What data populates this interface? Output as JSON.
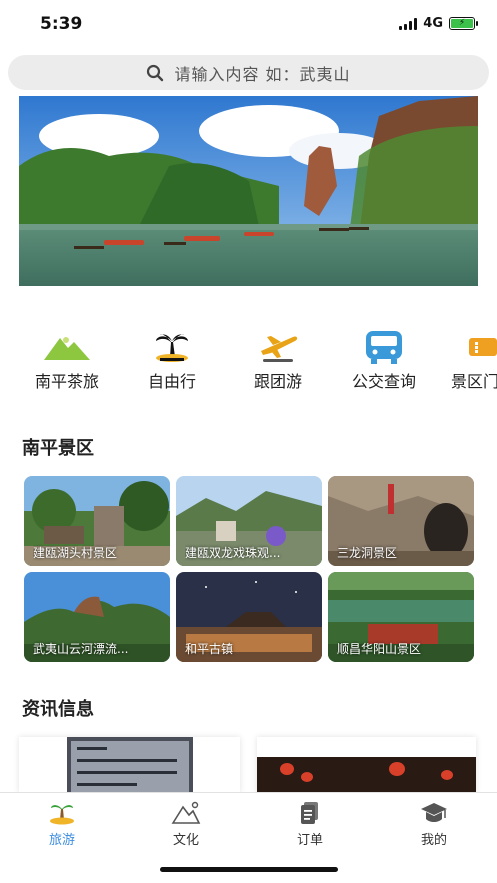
{
  "status_bar": {
    "time": "5:39",
    "network": "4G"
  },
  "search": {
    "placeholder": "请输入内容  如：武夷山",
    "icon": "search-icon"
  },
  "banner": {
    "scene": "river-valley-rafting"
  },
  "categories": [
    {
      "label": "南平茶旅",
      "icon": "tea-mountain-icon"
    },
    {
      "label": "自由行",
      "icon": "palm-island-icon"
    },
    {
      "label": "跟团游",
      "icon": "airplane-icon"
    },
    {
      "label": "公交查询",
      "icon": "bus-icon"
    },
    {
      "label": "景区门",
      "icon": "ticket-icon"
    }
  ],
  "scenic": {
    "title": "南平景区",
    "items": [
      {
        "label": "建瓯湖头村景区"
      },
      {
        "label": "建瓯双龙戏珠观..."
      },
      {
        "label": "三龙洞景区"
      },
      {
        "label": "武夷山云河漂流..."
      },
      {
        "label": "和平古镇"
      },
      {
        "label": "顺昌华阳山景区"
      }
    ]
  },
  "news": {
    "title": "资讯信息"
  },
  "tabbar": {
    "items": [
      {
        "label": "旅游",
        "icon": "palm-island-icon",
        "active": true
      },
      {
        "label": "文化",
        "icon": "mountain-outline-icon",
        "active": false
      },
      {
        "label": "订单",
        "icon": "document-icon",
        "active": false
      },
      {
        "label": "我的",
        "icon": "graduation-cap-icon",
        "active": false
      }
    ]
  },
  "colors": {
    "accent": "#3d8ee0",
    "bus": "#3a9ad9",
    "airplane": "#e8a317",
    "ticket": "#f0a020",
    "tea": "#8dc63f"
  }
}
